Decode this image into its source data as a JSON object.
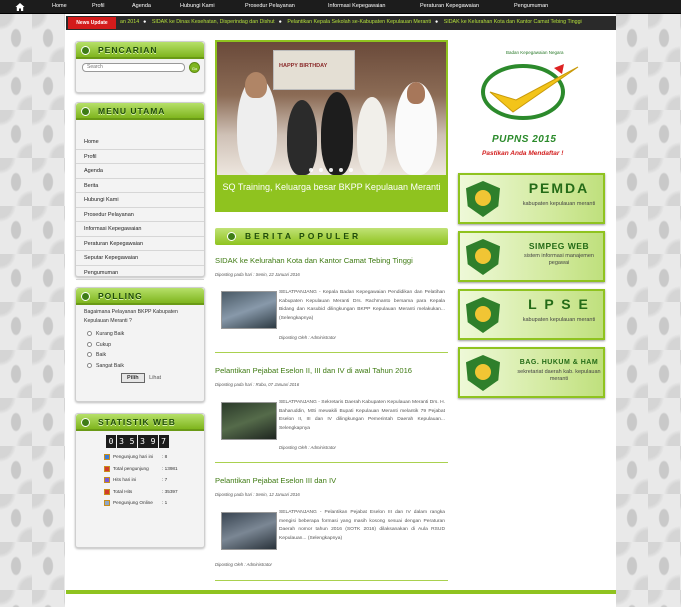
{
  "topnav": {
    "items": [
      "Home",
      "Profil",
      "Agenda",
      "Hubungi Kami",
      "Prosedur Pelayanan",
      "Informasi Kepegawaian",
      "Peraturan Kepegawaian",
      "Pengumuman"
    ]
  },
  "ticker": {
    "label": "News Update",
    "items": [
      "an 2014",
      "SIDAK ke Dinas Kesehatan, Disperindag dan Dishut",
      "Pelantikan Kepala Sekolah se-Kabupaten Kepulauan Meranti",
      "SIDAK ke Kelurahan Kota dan Kantor Camat Tebing Tinggi"
    ]
  },
  "search": {
    "title": "PENCARIAN",
    "placeholder": "Search",
    "button": "Go"
  },
  "menu": {
    "title": "MENU UTAMA",
    "items": [
      "Home",
      "Profil",
      "Agenda",
      "Berita",
      "Hubungi Kami",
      "Prosedur Pelayanan",
      "Informasi Kepegawaian",
      "Peraturan Kepegawaian",
      "Seputar Kepegawaian",
      "Pengumuman"
    ]
  },
  "poll": {
    "title": "POLLING",
    "question": "Bagaimana Pelayanan BKPP Kabupaten Kepulauan Meranti ?",
    "options": [
      "Kurang Baik",
      "Cukup",
      "Baik",
      "Sangat Baik"
    ],
    "vote": "Pilih",
    "view": "Lihat"
  },
  "stats": {
    "title": "STATISTIK WEB",
    "counter": [
      "0",
      "3",
      "5",
      "3",
      "9",
      "7"
    ],
    "rows": [
      {
        "k": "Pengunjung hari ini",
        "v": ": 8"
      },
      {
        "k": "Total pengunjung",
        "v": ": 13981"
      },
      {
        "k": "Hits hari ini",
        "v": ": 7"
      },
      {
        "k": "Total Hits",
        "v": ": 35397"
      },
      {
        "k": "Pengunjung Online",
        "v": ": 1"
      }
    ]
  },
  "slider": {
    "banner_text": "HAPPY BIRTHDAY",
    "caption": "SQ Training, Keluarga besar BKPP Kepulauan Meranti"
  },
  "populer": {
    "title": "BERITA POPULER",
    "posts": [
      {
        "title": "SIDAK ke Kelurahan Kota dan Kantor Camat Tebing Tinggi",
        "meta": "Diposting pada hari : Senin, 22 Januari 2016",
        "body": "SELATPANJANG - Kepala Badan Kepegawaian Pendidikan dan Pelatihan Kabupaten Kepulauan Meranti Drs. Rachmanto bersama para Kepala Bidang dan Kasubid dilingkungan BKPP Kepulauan Meranti melakukan... (Selengkapnya)",
        "by": "Diposting Oleh : Administrator"
      },
      {
        "title": "Pelantikan Pejabat Eselon II, III dan IV di awal Tahun 2016",
        "meta": "Diposting pada hari : Rabu, 07 Januari 2016",
        "body": "SELATPANJANG - Sekretaris Daerah Kabupaten Kepulauan Meranti Drs. H. Baharuddin, MSi mewakili Bupati Kepulauan Meranti melantik 79 Pejabat Eselon II, III dan IV dilingkungan Pemerintah Daerah Kepulauan... Selengkapnya",
        "by": "Diposting Oleh : Administrator"
      },
      {
        "title": "Pelantikan Pejabat Eselon III dan IV",
        "meta": "Diposting pada hari : Senin, 12 Januari 2016",
        "body": "SELATPANJANG - Pelantikan Pejabat Eselon III dan IV dalam rangka mengisi beberapa formasi yang masih kosong sesuai dengan Peraturan Daerah nomor tahun 2016 (SOTK 2016) dilaksanakan di Aula RSUD Kepulauan... (Selengkapnya)",
        "by": "Diposting Oleh : Administrator"
      }
    ]
  },
  "pupr": {
    "arc_text": "Badan Kepegawaian Negara",
    "brand": "PUPNS 2015",
    "tagline": "Pastikan Anda Mendaftar !"
  },
  "banners": [
    {
      "big": "PEMDA",
      "sub": "kabupaten kepulauan meranti"
    },
    {
      "big": "SIMPEG WEB",
      "sub": "sistem informasi manajemen pegawai"
    },
    {
      "big": "L P S E",
      "sub": "kabupaten kepulauan meranti"
    },
    {
      "big": "BAG. HUKUM & HAM",
      "sub": "sekretariat daerah kab. kepulauan meranti"
    }
  ]
}
